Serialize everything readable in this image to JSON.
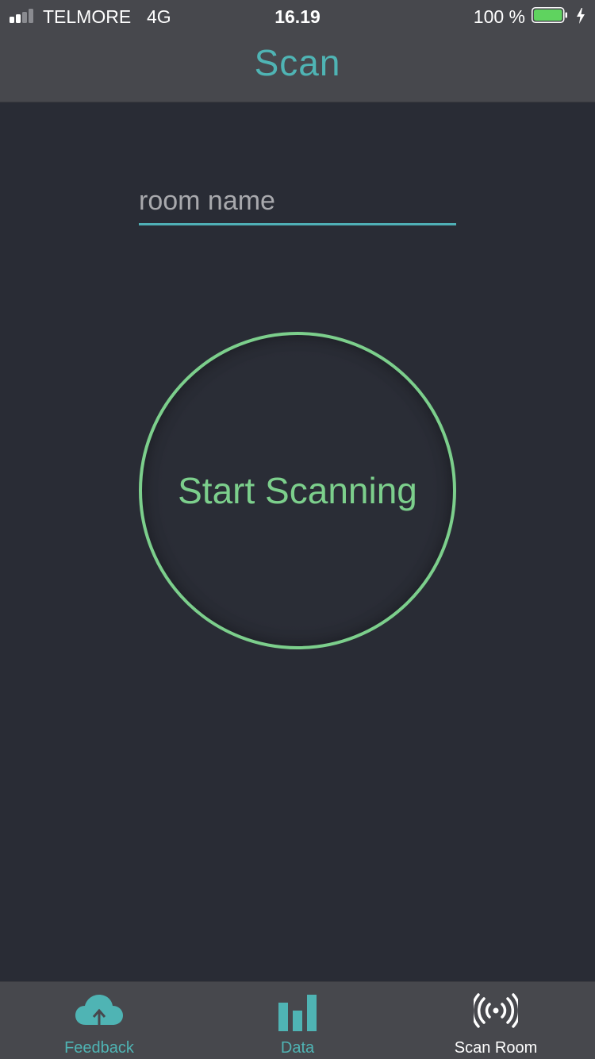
{
  "status_bar": {
    "carrier": "TELMORE",
    "network": "4G",
    "time": "16.19",
    "battery_percent": "100 %",
    "signal_bars_filled": 2,
    "signal_bars_total": 4,
    "battery_level": 1.0
  },
  "nav": {
    "title": "Scan"
  },
  "room_input": {
    "placeholder": "room name",
    "value": ""
  },
  "scan_button": {
    "label": "Start Scanning"
  },
  "tabs": [
    {
      "label": "Feedback",
      "icon": "cloud-upload-icon",
      "active": false
    },
    {
      "label": "Data",
      "icon": "bar-chart-icon",
      "active": false
    },
    {
      "label": "Scan Room",
      "icon": "broadcast-icon",
      "active": true
    }
  ],
  "colors": {
    "background": "#292c35",
    "bar_background": "#47484d",
    "accent_teal": "#4fb4b4",
    "scan_green": "#7ccf8c",
    "battery_green": "#5fd35f",
    "tab_active": "#ffffff",
    "tab_inactive": "#4fb4b4"
  }
}
